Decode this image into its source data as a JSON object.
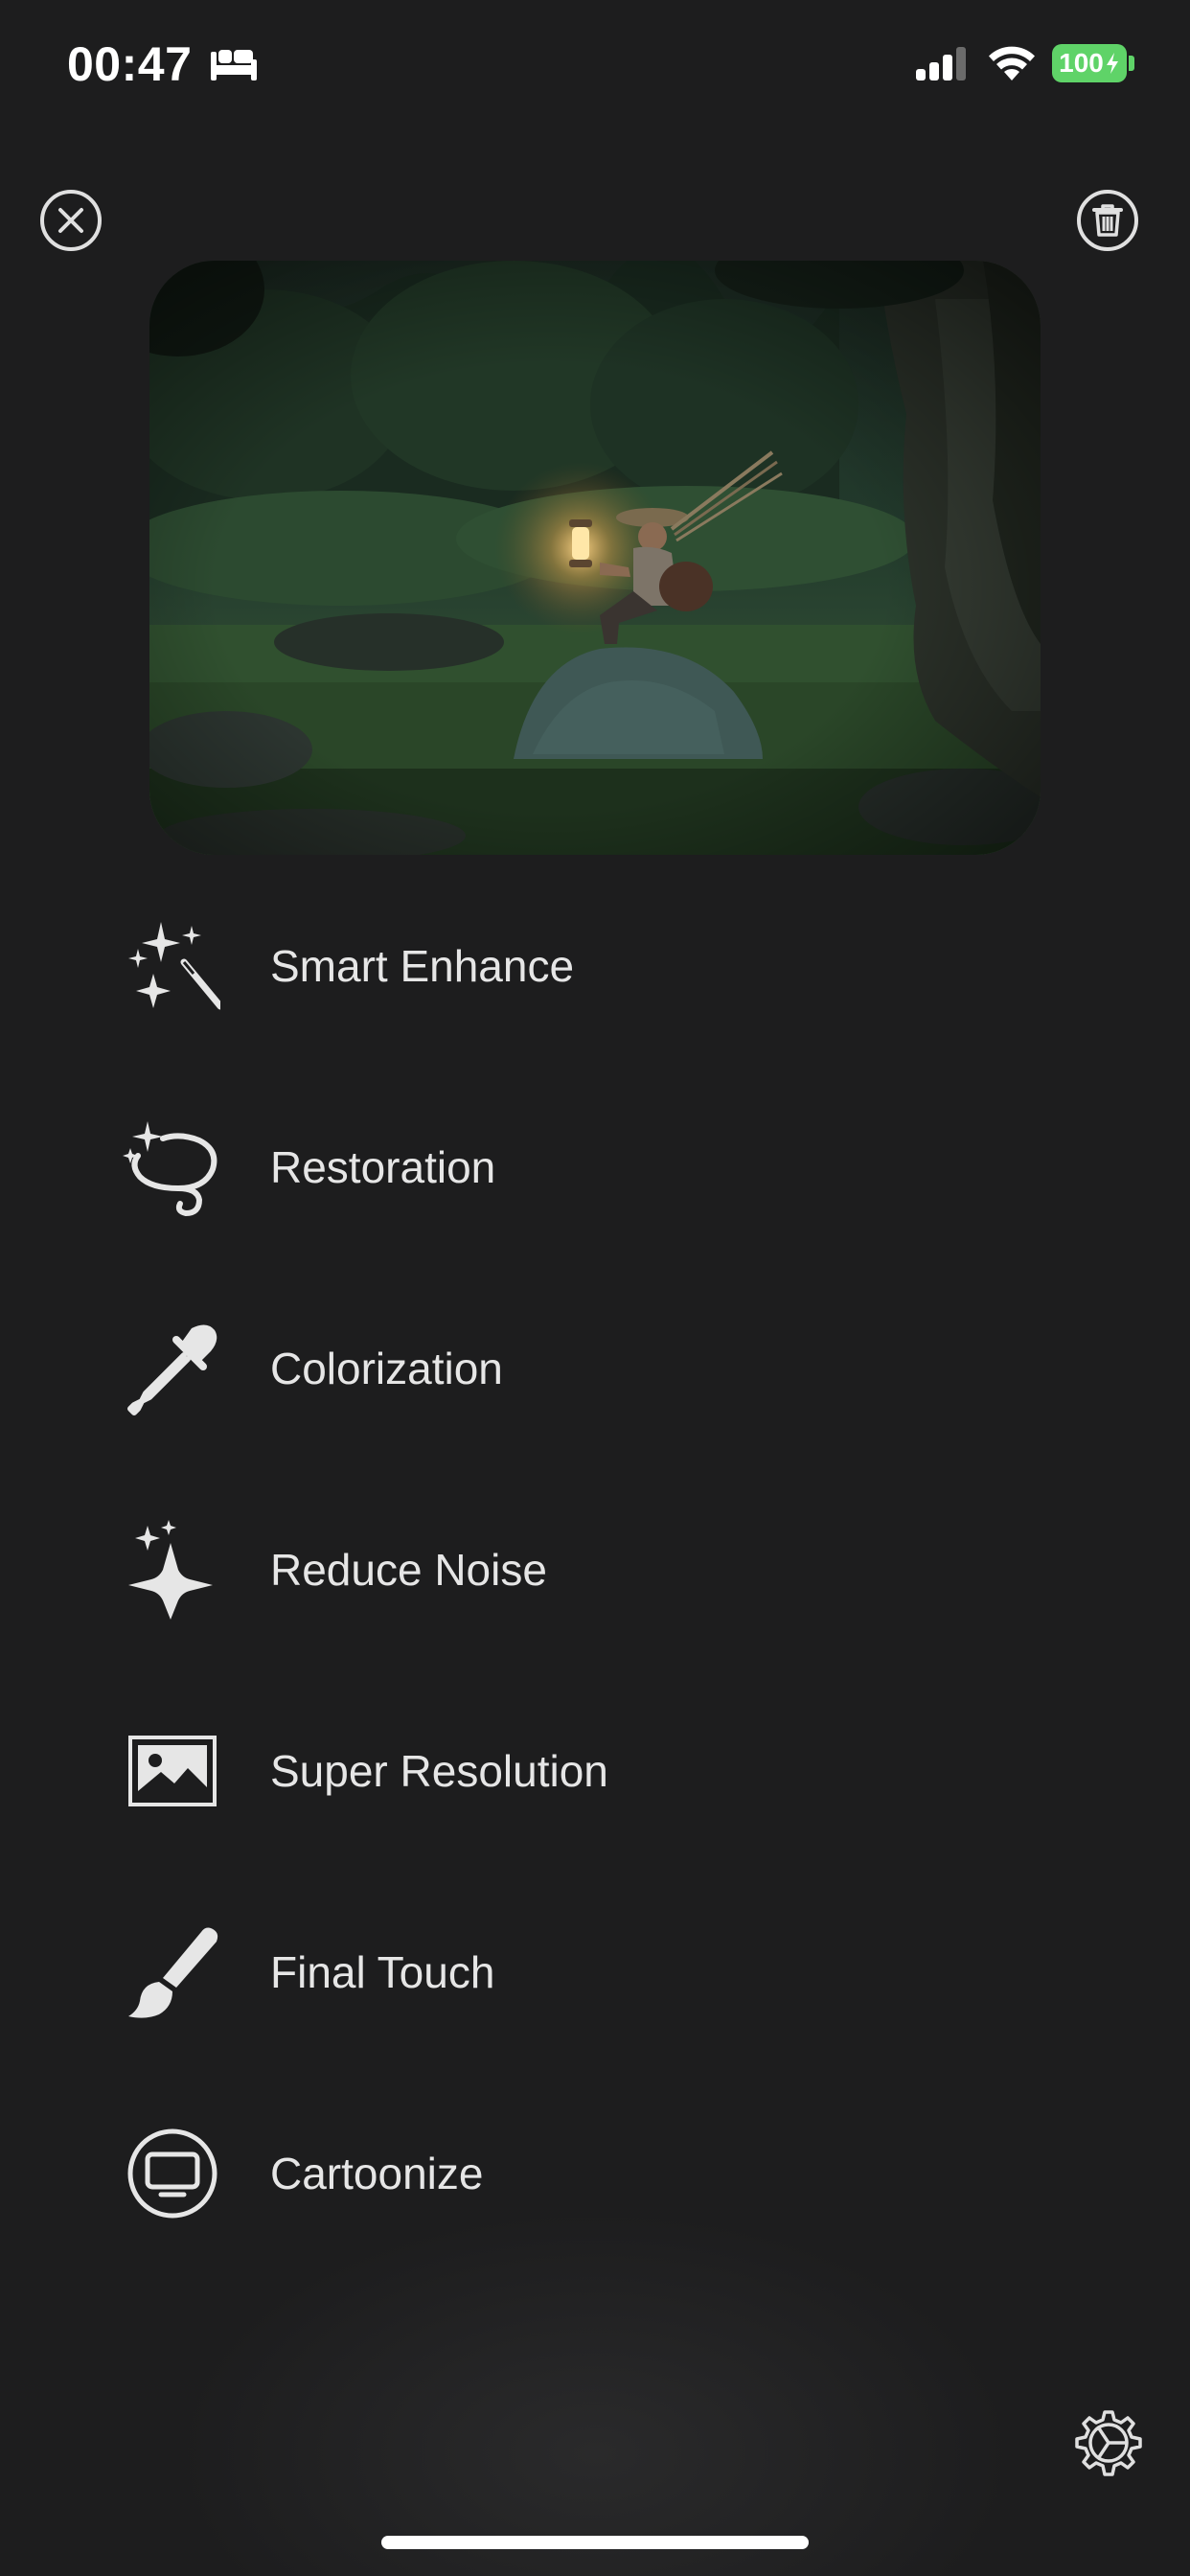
{
  "status_bar": {
    "time": "00:47",
    "battery_level": "100",
    "battery_color": "#5fd368"
  },
  "top_bar": {
    "close_icon": "close-icon",
    "trash_icon": "trash-icon"
  },
  "menu": {
    "items": [
      {
        "label": "Smart Enhance",
        "icon": "magic-wand-sparkles-icon"
      },
      {
        "label": "Restoration",
        "icon": "sparkle-loop-icon"
      },
      {
        "label": "Colorization",
        "icon": "eyedropper-icon"
      },
      {
        "label": "Reduce Noise",
        "icon": "sparkles-icon"
      },
      {
        "label": "Super Resolution",
        "icon": "image-frame-icon"
      },
      {
        "label": "Final Touch",
        "icon": "paintbrush-icon"
      },
      {
        "label": "Cartoonize",
        "icon": "tv-circle-icon"
      }
    ]
  },
  "footer": {
    "settings_icon": "settings-icon"
  },
  "theme": {
    "background": "#1d1d1e",
    "text": "#e6e6e6"
  }
}
